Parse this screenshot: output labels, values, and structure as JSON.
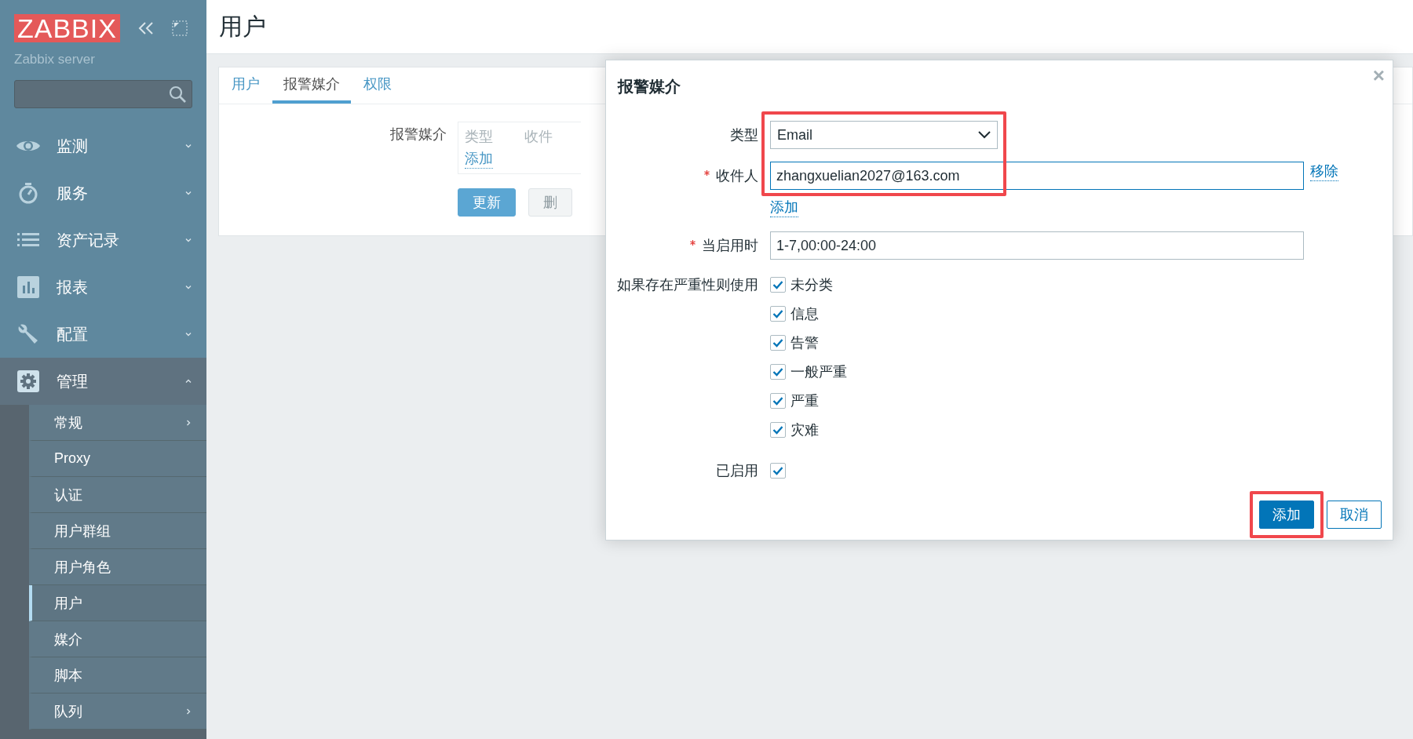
{
  "sidebar": {
    "logo": "ZABBIX",
    "server_name": "Zabbix server",
    "menu": [
      {
        "label": "监测",
        "expanded": false
      },
      {
        "label": "服务",
        "expanded": false
      },
      {
        "label": "资产记录",
        "expanded": false
      },
      {
        "label": "报表",
        "expanded": false
      },
      {
        "label": "配置",
        "expanded": false
      },
      {
        "label": "管理",
        "expanded": true,
        "children": [
          {
            "label": "常规",
            "has_submenu": true,
            "selected": false
          },
          {
            "label": "Proxy",
            "has_submenu": false,
            "selected": false
          },
          {
            "label": "认证",
            "has_submenu": false,
            "selected": false
          },
          {
            "label": "用户群组",
            "has_submenu": false,
            "selected": false
          },
          {
            "label": "用户角色",
            "has_submenu": false,
            "selected": false
          },
          {
            "label": "用户",
            "has_submenu": false,
            "selected": true
          },
          {
            "label": "媒介",
            "has_submenu": false,
            "selected": false
          },
          {
            "label": "脚本",
            "has_submenu": false,
            "selected": false
          },
          {
            "label": "队列",
            "has_submenu": true,
            "selected": false
          }
        ]
      }
    ]
  },
  "page": {
    "title": "用户",
    "tabs": [
      {
        "label": "用户",
        "selected": false
      },
      {
        "label": "报警媒介",
        "selected": true
      },
      {
        "label": "权限",
        "selected": false
      }
    ],
    "media": {
      "label": "报警媒介",
      "columns": [
        "类型",
        "收件"
      ],
      "add_link": "添加"
    },
    "buttons": [
      {
        "label": "更新",
        "kind": "primary"
      },
      {
        "label": "删",
        "kind": "disabled"
      }
    ]
  },
  "dialog": {
    "title": "报警媒介",
    "close": "×",
    "type": {
      "label": "类型",
      "value": "Email"
    },
    "recipient": {
      "label": "收件人",
      "required": true,
      "value": "zhangxuelian2027@163.com",
      "remove_link": "移除",
      "add_link": "添加"
    },
    "fields_highlighted": true,
    "when_active": {
      "label": "当启用时",
      "required": true,
      "value": "1-7,00:00-24:00"
    },
    "severity": {
      "label": "如果存在严重性则使用",
      "options": [
        {
          "label": "未分类",
          "checked": true
        },
        {
          "label": "信息",
          "checked": true
        },
        {
          "label": "告警",
          "checked": true
        },
        {
          "label": "一般严重",
          "checked": true
        },
        {
          "label": "严重",
          "checked": true
        },
        {
          "label": "灾难",
          "checked": true
        }
      ]
    },
    "enabled": {
      "label": "已启用",
      "checked": true
    },
    "buttons": [
      {
        "label": "添加",
        "kind": "primary",
        "highlighted": true
      },
      {
        "label": "取消",
        "kind": "secondary",
        "highlighted": false
      }
    ]
  }
}
